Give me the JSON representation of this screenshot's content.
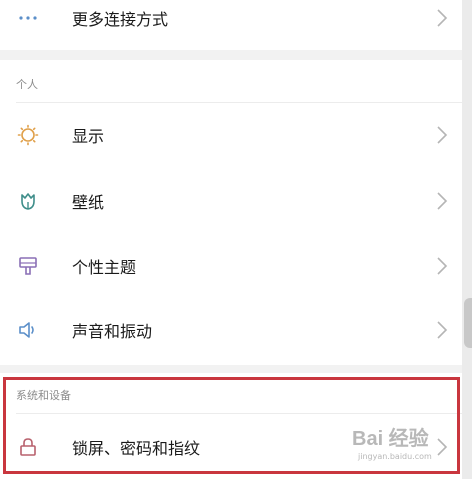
{
  "top": {
    "more_connect": "更多连接方式"
  },
  "personal": {
    "header": "个人",
    "items": [
      {
        "label": "显示",
        "icon": "sun-icon"
      },
      {
        "label": "壁纸",
        "icon": "tulip-icon"
      },
      {
        "label": "个性主题",
        "icon": "brush-icon"
      },
      {
        "label": "声音和振动",
        "icon": "speaker-icon"
      }
    ]
  },
  "system": {
    "header": "系统和设备",
    "items": [
      {
        "label": "锁屏、密码和指纹",
        "icon": "lock-icon"
      }
    ]
  },
  "watermark": {
    "brand": "Bai 经验",
    "url": "jingyan.baidu.com"
  },
  "colors": {
    "icon_blue": "#5b8fc9",
    "sun_orange": "#e0a04a",
    "tulip_teal": "#3f8e8a",
    "brush_purple": "#8a6fb6",
    "lock_red": "#b8616d",
    "highlight_red": "#c9363e"
  }
}
